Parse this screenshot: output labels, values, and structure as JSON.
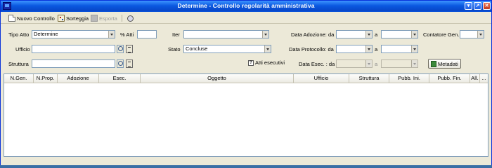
{
  "window": {
    "title": "Determine - Controllo regolarità amministrativa"
  },
  "toolbar": {
    "new_label": "Nuovo Controllo",
    "draw_label": "Sorteggia",
    "export_label": "Esporta"
  },
  "filters": {
    "tipo_atto": {
      "label": "Tipo Atto",
      "value": "Determine"
    },
    "perc_atti": {
      "label": "% Atti",
      "value": ""
    },
    "iter": {
      "label": "Iter",
      "value": ""
    },
    "data_adozione": {
      "label": "Data Adozione: da",
      "from": "",
      "a_label": "a",
      "to": ""
    },
    "contatore": {
      "label": "Contatore Gen.",
      "value": ""
    },
    "ufficio": {
      "label": "Ufficio",
      "value": ""
    },
    "stato": {
      "label": "Stato",
      "value": "Concluse"
    },
    "data_protocollo": {
      "label": "Data Protocollo: da",
      "from": "",
      "a_label": "a",
      "to": ""
    },
    "struttura": {
      "label": "Struttura",
      "value": ""
    },
    "atti_esecutivi": {
      "label": "Atti esecutivi",
      "checked": false
    },
    "data_esec": {
      "label": "Data Esec. : da",
      "from": "",
      "a_label": "a",
      "to": ""
    },
    "metadati_label": "Metadati"
  },
  "grid": {
    "columns": [
      "N.Gen.",
      "N.Prop.",
      "Adozione",
      "Esec.",
      "Oggetto",
      "Ufficio",
      "Struttura",
      "Pubb. Ini.",
      "Pubb. Fin.",
      "All.",
      "..."
    ],
    "rows": []
  },
  "colors": {
    "titlebar": "#0a58e0",
    "window_bg": "#ece9d8",
    "field_border": "#7f9db9"
  }
}
